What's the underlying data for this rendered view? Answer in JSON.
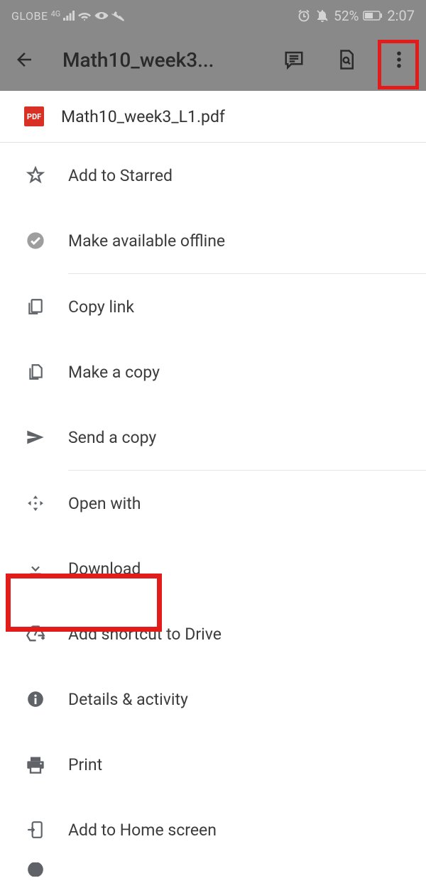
{
  "status": {
    "carrier": "GLOBE",
    "network": "4G",
    "battery": "52%",
    "time": "2:07"
  },
  "appbar": {
    "title": "Math10_week3..."
  },
  "file": {
    "name": "Math10_week3_L1.pdf",
    "badge": "PDF"
  },
  "menu": {
    "starred": "Add to Starred",
    "offline": "Make available offline",
    "copylink": "Copy link",
    "makecopy": "Make a copy",
    "sendcopy": "Send a copy",
    "openwith": "Open with",
    "download": "Download",
    "shortcut": "Add shortcut to Drive",
    "details": "Details & activity",
    "print": "Print",
    "homescreen": "Add to Home screen"
  }
}
